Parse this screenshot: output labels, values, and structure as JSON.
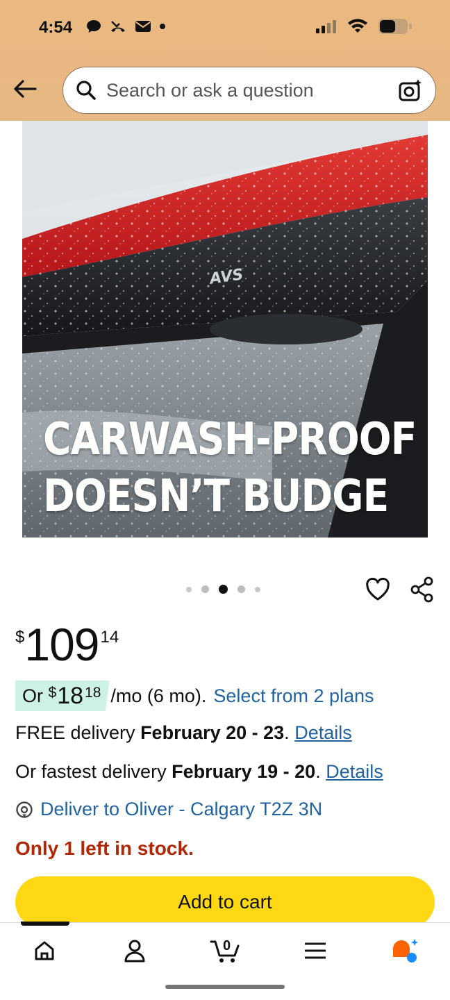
{
  "status_bar": {
    "time": "4:54"
  },
  "search": {
    "placeholder": "Search or ask a question"
  },
  "hero": {
    "line1": "CARWASH-PROOF",
    "line2": "DOESN’T BUDGE",
    "logo": "AVS"
  },
  "carousel": {
    "count": 5,
    "active_index": 2
  },
  "price": {
    "symbol": "$",
    "whole": "109",
    "fraction": "14"
  },
  "plan": {
    "prefix": "Or ",
    "symbol": "$",
    "whole": "18",
    "fraction": "18",
    "suffix": "/mo (6 mo).",
    "link": "Select from 2 plans"
  },
  "delivery": {
    "free_prefix": "FREE delivery ",
    "free_dates": "February 20 - 23",
    "details": "Details",
    "fast_prefix": "Or fastest delivery ",
    "fast_dates": "February 19 - 20",
    "period": "."
  },
  "deliver_to": "Deliver to Oliver - Calgary T2Z 3N",
  "stock": "Only 1 left in stock.",
  "add_to_cart": "Add to cart",
  "cart_count": "0",
  "colors": {
    "accent_yellow": "#ffd814",
    "link_blue": "#2162a1",
    "stock_red": "#b12704",
    "plan_chip": "#cdf2e3",
    "header": "#eab980"
  },
  "icons": [
    "back-arrow-icon",
    "search-icon",
    "camera-sparkle-icon",
    "heart-icon",
    "share-icon",
    "location-pin-icon",
    "home-icon",
    "account-icon",
    "cart-icon",
    "menu-icon",
    "rufus-ai-icon"
  ]
}
